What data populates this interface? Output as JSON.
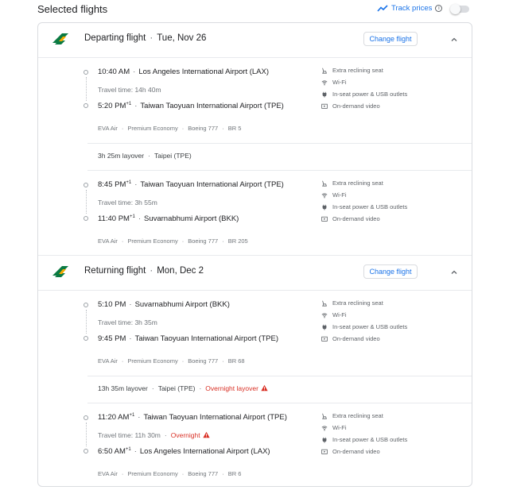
{
  "header": {
    "title": "Selected flights",
    "track_prices": "Track prices"
  },
  "colors": {
    "accent": "#1a73e8",
    "warning": "#d93025",
    "airline_green": "#0a7a42"
  },
  "icons": [
    "eva-air-logo-icon",
    "trend-icon",
    "info-icon",
    "chevron-up-icon",
    "seat-icon",
    "wifi-icon",
    "power-plug-icon",
    "video-icon",
    "warning-icon"
  ],
  "departing": {
    "title": "Departing flight",
    "date": "Tue, Nov 26",
    "change_label": "Change flight",
    "segments": [
      {
        "dep_time": "10:40 AM",
        "dep_sup": "",
        "dep_airport": "Los Angeles International Airport (LAX)",
        "travel": "Travel time: 14h 40m",
        "travel_warn": "",
        "arr_time": "5:20 PM",
        "arr_sup": "+1",
        "arr_airport": "Taiwan Taoyuan International Airport (TPE)",
        "airline": "EVA Air",
        "cabin": "Premium Economy",
        "aircraft": "Boeing 777",
        "flight_no": "BR 5",
        "amenities": [
          "Extra reclining seat",
          "Wi-Fi",
          "In-seat power & USB outlets",
          "On-demand video"
        ]
      },
      {
        "dep_time": "8:45 PM",
        "dep_sup": "+1",
        "dep_airport": "Taiwan Taoyuan International Airport (TPE)",
        "travel": "Travel time: 3h 55m",
        "travel_warn": "",
        "arr_time": "11:40 PM",
        "arr_sup": "+1",
        "arr_airport": "Suvarnabhumi Airport (BKK)",
        "airline": "EVA Air",
        "cabin": "Premium Economy",
        "aircraft": "Boeing 777",
        "flight_no": "BR 205",
        "amenities": [
          "Extra reclining seat",
          "Wi-Fi",
          "In-seat power & USB outlets",
          "On-demand video"
        ]
      }
    ],
    "layover": {
      "duration": "3h 25m layover",
      "city": "Taipei (TPE)",
      "warning": ""
    }
  },
  "returning": {
    "title": "Returning flight",
    "date": "Mon, Dec 2",
    "change_label": "Change flight",
    "segments": [
      {
        "dep_time": "5:10 PM",
        "dep_sup": "",
        "dep_airport": "Suvarnabhumi Airport (BKK)",
        "travel": "Travel time: 3h 35m",
        "travel_warn": "",
        "arr_time": "9:45 PM",
        "arr_sup": "",
        "arr_airport": "Taiwan Taoyuan International Airport (TPE)",
        "airline": "EVA Air",
        "cabin": "Premium Economy",
        "aircraft": "Boeing 777",
        "flight_no": "BR 68",
        "amenities": [
          "Extra reclining seat",
          "Wi-Fi",
          "In-seat power & USB outlets",
          "On-demand video"
        ]
      },
      {
        "dep_time": "11:20 AM",
        "dep_sup": "+1",
        "dep_airport": "Taiwan Taoyuan International Airport (TPE)",
        "travel": "Travel time: 11h 30m",
        "travel_warn": "Overnight",
        "arr_time": "6:50 AM",
        "arr_sup": "+1",
        "arr_airport": "Los Angeles International Airport (LAX)",
        "airline": "EVA Air",
        "cabin": "Premium Economy",
        "aircraft": "Boeing 777",
        "flight_no": "BR 6",
        "amenities": [
          "Extra reclining seat",
          "Wi-Fi",
          "In-seat power & USB outlets",
          "On-demand video"
        ]
      }
    ],
    "layover": {
      "duration": "13h 35m layover",
      "city": "Taipei (TPE)",
      "warning": "Overnight layover"
    }
  }
}
